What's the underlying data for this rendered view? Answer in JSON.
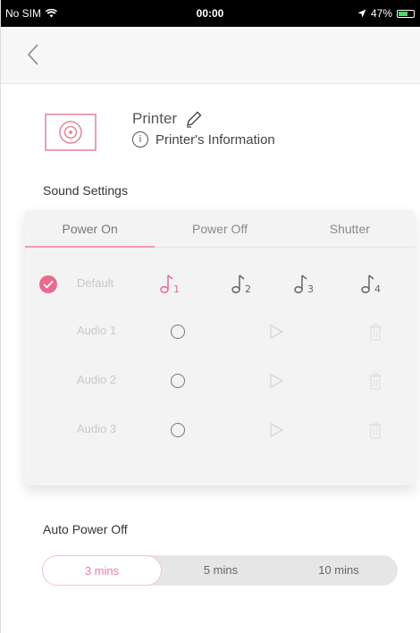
{
  "status_bar": {
    "carrier": "No SIM",
    "time": "00:00",
    "battery": "47%"
  },
  "printer": {
    "name": "Printer",
    "info_label": "Printer's Information"
  },
  "sound_settings": {
    "title": "Sound Settings",
    "tabs": [
      "Power On",
      "Power Off",
      "Shutter"
    ],
    "active_tab": "Power On",
    "default_label": "Default",
    "tone_labels": [
      "1",
      "2",
      "3",
      "4"
    ],
    "selected_tone": "1",
    "audio_rows": [
      "Audio 1",
      "Audio 2",
      "Audio 3"
    ]
  },
  "auto_power_off": {
    "title": "Auto Power Off",
    "options": [
      "3 mins",
      "5 mins",
      "10 mins"
    ],
    "selected": "3 mins"
  },
  "colors": {
    "accent": "#e96a8c",
    "accent_light": "#f19ab0"
  },
  "icons": {
    "back": "chevron-left-icon",
    "edit": "pencil-icon",
    "info": "info-icon",
    "tone": "music-note-icon",
    "play": "play-icon",
    "delete": "trash-icon"
  }
}
